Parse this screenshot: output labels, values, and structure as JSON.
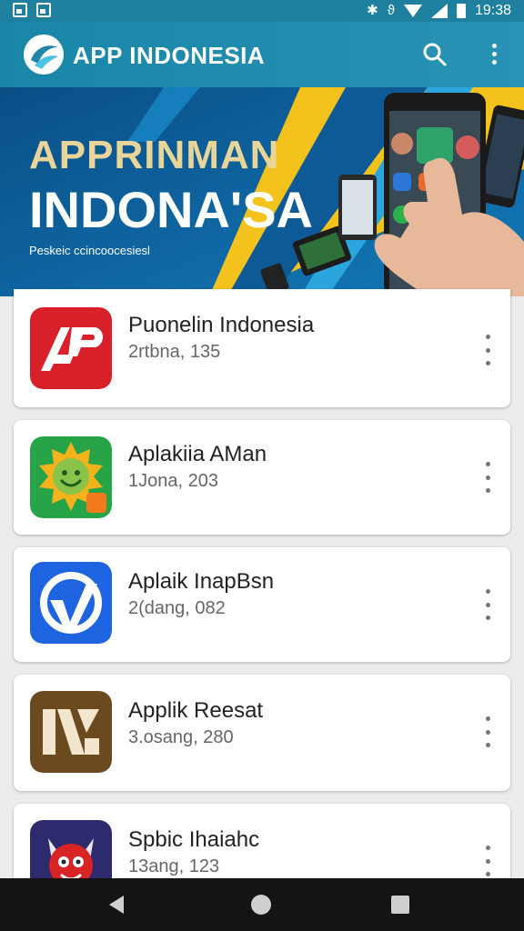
{
  "status_bar": {
    "time": "19:38"
  },
  "app_bar": {
    "title": "APP INDONESIA"
  },
  "banner": {
    "line1": "APPRINMAN",
    "line2": "INDONA'SA",
    "line3": "Peskeic ccincoocesiesl"
  },
  "apps": [
    {
      "name": "Puonelin Indonesia",
      "meta": "2rtbna, 135",
      "icon": "ap-red-icon"
    },
    {
      "name": "Aplakiia AMan",
      "meta": "1Jona, 203",
      "icon": "green-sun-face-icon"
    },
    {
      "name": "Aplaik InapBsn",
      "meta": "2(dang, 082",
      "icon": "blue-arrow-icon"
    },
    {
      "name": "Applik Reesat",
      "meta": "3.osang, 280",
      "icon": "brown-letters-icon"
    },
    {
      "name": "Spbic Ihaiahc",
      "meta": "13ang, 123",
      "icon": "red-mascot-icon"
    }
  ],
  "colors": {
    "primary": "#1f86a7",
    "banner_blue": "#0c5e98",
    "banner_yellow": "#f4c21c",
    "nav_bar": "#141414"
  }
}
